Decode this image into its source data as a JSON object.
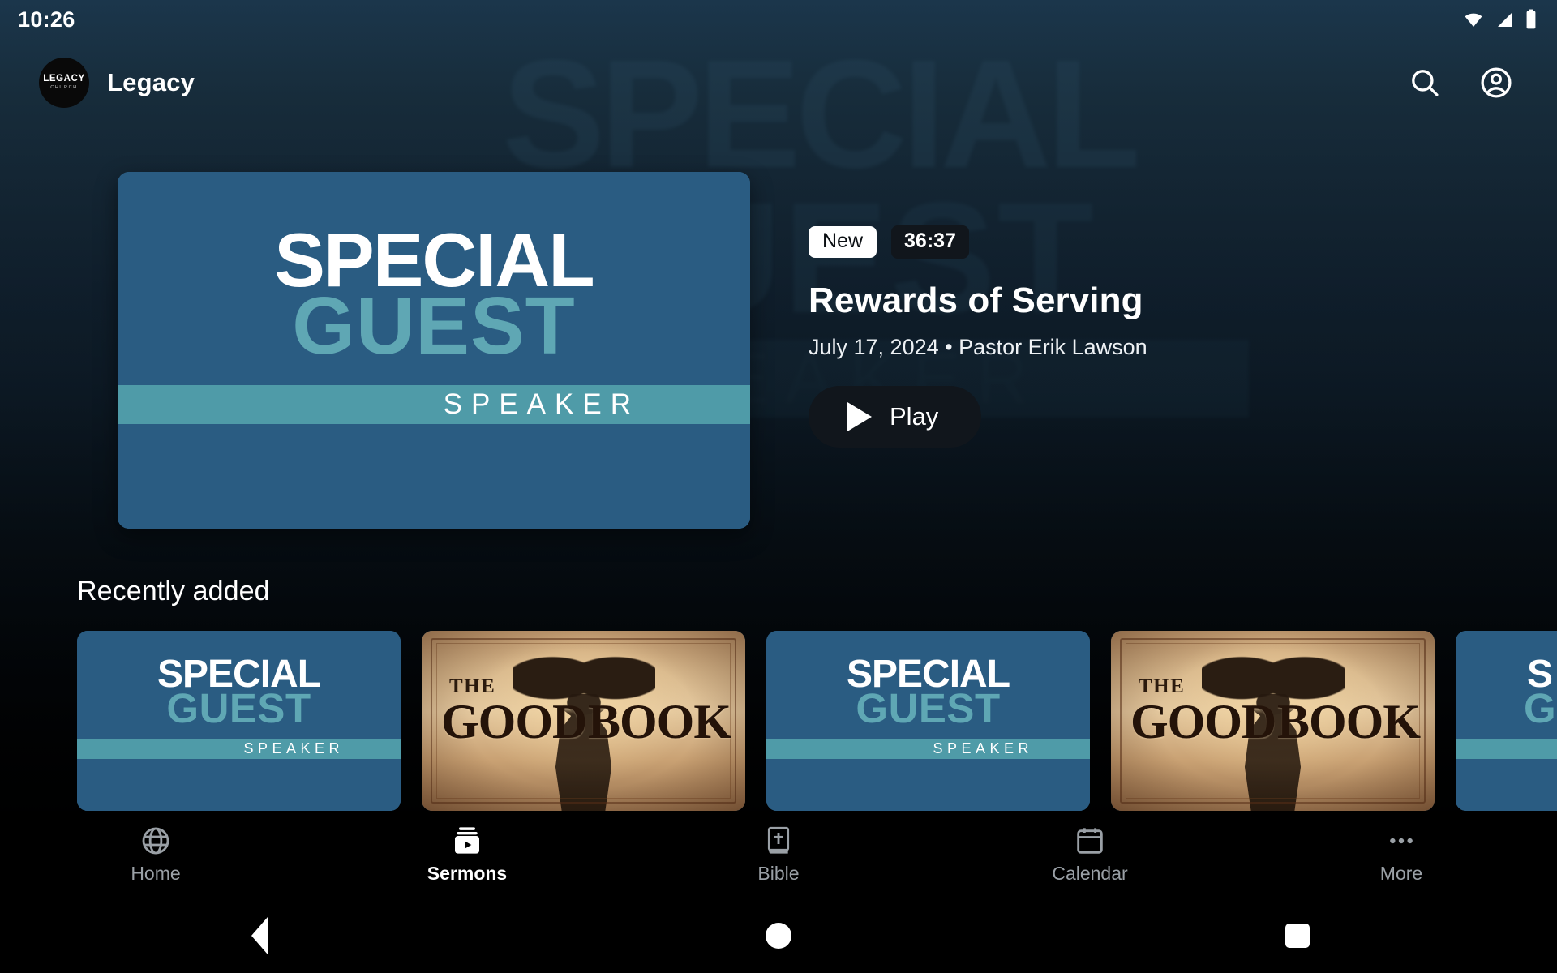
{
  "status_bar": {
    "time": "10:26",
    "icons": [
      "wifi-icon",
      "cellular-signal-icon",
      "battery-icon"
    ]
  },
  "app_bar": {
    "logo": {
      "line1": "LEGACY",
      "line2": "CHURCH"
    },
    "title": "Legacy",
    "actions": [
      {
        "name": "search-icon",
        "label": "Search"
      },
      {
        "name": "account-circle-icon",
        "label": "Account"
      }
    ]
  },
  "hero": {
    "thumbnail": {
      "special": "SPECIAL",
      "guest": "GUEST",
      "speaker": "SPEAKER"
    },
    "badge_new": "New",
    "badge_duration": "36:37",
    "title": "Rewards of Serving",
    "subtitle": "July 17, 2024 • Pastor Erik Lawson",
    "play_label": "Play"
  },
  "row": {
    "title": "Recently added",
    "cards": [
      {
        "type": "special-guest-speaker",
        "special": "SPECIAL",
        "guest": "GUEST",
        "speaker": "SPEAKER"
      },
      {
        "type": "the-good-book",
        "the": "THE",
        "good": "GOOD",
        "book": "BOOK"
      },
      {
        "type": "special-guest-speaker",
        "special": "SPECIAL",
        "guest": "GUEST",
        "speaker": "SPEAKER"
      },
      {
        "type": "the-good-book",
        "the": "THE",
        "good": "GOOD",
        "book": "BOOK"
      },
      {
        "type": "special-guest-speaker",
        "special": "S",
        "guest": "G",
        "speaker": ""
      }
    ]
  },
  "bottom_nav": {
    "items": [
      {
        "label": "Home",
        "icon": "globe-icon",
        "active": false
      },
      {
        "label": "Sermons",
        "icon": "video-library-icon",
        "active": true
      },
      {
        "label": "Bible",
        "icon": "bible-book-icon",
        "active": false
      },
      {
        "label": "Calendar",
        "icon": "calendar-icon",
        "active": false
      },
      {
        "label": "More",
        "icon": "more-horizontal-icon",
        "active": false
      }
    ]
  },
  "system_nav": {
    "back": "back-button",
    "home": "home-button",
    "recents": "recents-button"
  },
  "colors": {
    "card_blue": "#2a5c82",
    "card_teal": "#4f9ba8",
    "guest_teal": "#5fa7b4",
    "nav_inactive": "#9aa0a6",
    "badge_dark": "#11161c",
    "backdrop_top": "#21415a"
  }
}
